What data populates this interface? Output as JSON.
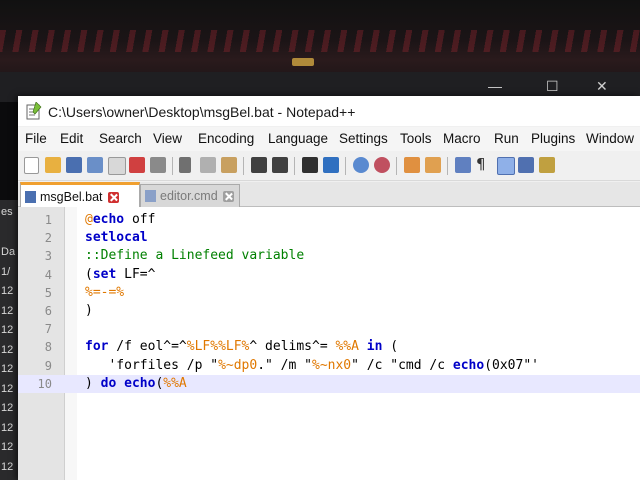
{
  "window": {
    "title": "C:\\Users\\owner\\Desktop\\msgBel.bat - Notepad++"
  },
  "menu": [
    "File",
    "Edit",
    "Search",
    "View",
    "Encoding",
    "Language",
    "Settings",
    "Tools",
    "Macro",
    "Run",
    "Plugins",
    "Window"
  ],
  "tabs": [
    {
      "label": "msgBel.bat",
      "active": true
    },
    {
      "label": "editor.cmd",
      "active": false
    }
  ],
  "background_left_labels": [
    "es",
    "Da",
    "1/",
    "12",
    "12",
    "12",
    "12",
    "12",
    "12",
    "12",
    "12",
    "12",
    "12"
  ],
  "editor": {
    "current_line": 10,
    "lines": [
      {
        "n": "1",
        "parts": [
          {
            "t": "@",
            "c": "op"
          },
          {
            "t": "echo",
            "c": "kw"
          },
          {
            "t": " off",
            "c": "str"
          }
        ]
      },
      {
        "n": "2",
        "parts": [
          {
            "t": "setlocal",
            "c": "kw"
          }
        ]
      },
      {
        "n": "3",
        "parts": [
          {
            "t": "::Define a Linefeed variable",
            "c": "cmt"
          }
        ]
      },
      {
        "n": "4",
        "parts": [
          {
            "t": "(",
            "c": "str"
          },
          {
            "t": "set",
            "c": "kw"
          },
          {
            "t": " LF=^",
            "c": "str"
          }
        ]
      },
      {
        "n": "5",
        "parts": [
          {
            "t": "%=-=%",
            "c": "var"
          }
        ]
      },
      {
        "n": "6",
        "parts": [
          {
            "t": ")",
            "c": "str"
          }
        ]
      },
      {
        "n": "7",
        "parts": []
      },
      {
        "n": "8",
        "parts": [
          {
            "t": "for",
            "c": "kw"
          },
          {
            "t": " /f eol^=^",
            "c": "str"
          },
          {
            "t": "%LF%%LF%",
            "c": "var"
          },
          {
            "t": "^ delims^= ",
            "c": "str"
          },
          {
            "t": "%%A",
            "c": "var"
          },
          {
            "t": " ",
            "c": "str"
          },
          {
            "t": "in",
            "c": "kw"
          },
          {
            "t": " (",
            "c": "str"
          }
        ]
      },
      {
        "n": "9",
        "parts": [
          {
            "t": "   'forfiles /p \"",
            "c": "str"
          },
          {
            "t": "%~dp0",
            "c": "var"
          },
          {
            "t": ".\" /m \"",
            "c": "str"
          },
          {
            "t": "%~nx0",
            "c": "var"
          },
          {
            "t": "\" /c \"cmd /c ",
            "c": "str"
          },
          {
            "t": "echo",
            "c": "kw"
          },
          {
            "t": "(0x07\"'",
            "c": "str"
          }
        ]
      },
      {
        "n": "10",
        "parts": [
          {
            "t": ") ",
            "c": "str"
          },
          {
            "t": "do",
            "c": "kw"
          },
          {
            "t": " ",
            "c": "str"
          },
          {
            "t": "echo",
            "c": "kw"
          },
          {
            "t": "(",
            "c": "str"
          },
          {
            "t": "%%A",
            "c": "var"
          }
        ]
      }
    ]
  }
}
